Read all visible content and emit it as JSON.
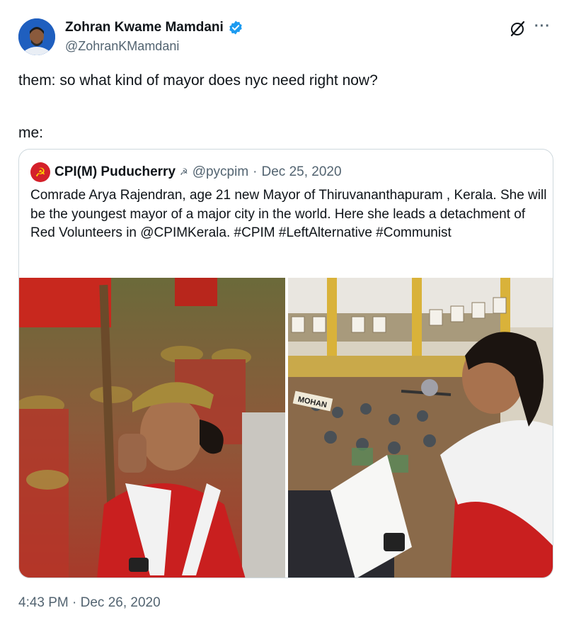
{
  "author": {
    "display_name": "Zohran Kwame Mamdani",
    "handle": "@ZohranKMamdani",
    "verified": true,
    "avatar_icon": "profile-photo-avatar"
  },
  "actions": {
    "grok_icon": "grok-icon",
    "more_label": "···"
  },
  "tweet": {
    "lines": [
      "them: so what kind of mayor does nyc need right now?",
      "me:"
    ],
    "timestamp": "4:43 PM · Dec 26, 2020"
  },
  "quoted_tweet": {
    "display_name": "CPI(M) Puducherry",
    "badge": "☭",
    "handle": "@pycpim",
    "separator": "·",
    "date": "Dec 25, 2020",
    "text": "Comrade Arya Rajendran, age 21  new Mayor of Thiruvananthapuram , Kerala. She will be the youngest mayor of a major city in the world. Here she leads a detachment of Red Volunteers in @CPIMKerala. #CPIM  #LeftAlternative #Communist",
    "media": [
      {
        "kind": "photo",
        "subject": "volunteer-march-photo"
      },
      {
        "kind": "photo",
        "subject": "council-speech-photo",
        "sign_text": "MOHAN"
      }
    ]
  },
  "colors": {
    "text_primary": "#0f1419",
    "text_secondary": "#536471",
    "border": "#cfd9de",
    "verified_blue": "#1d9bf0",
    "party_red": "#d4202a"
  }
}
